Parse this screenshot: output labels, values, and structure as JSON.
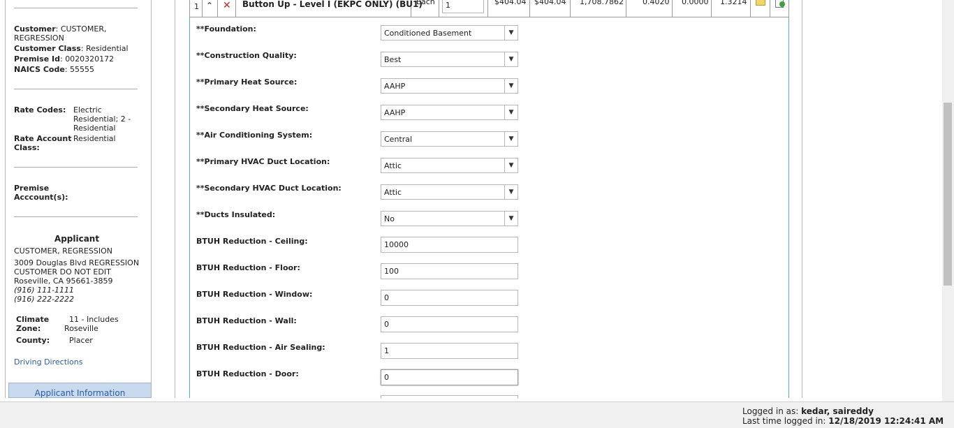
{
  "sidebar": {
    "customer_label": "Customer",
    "customer_value": "CUSTOMER,",
    "customer_value2": "REGRESSION",
    "customer_class_label": "Customer Class",
    "customer_class_value": "Residential",
    "premise_id_label": "Premise Id",
    "premise_id_value": "0020320172",
    "naics_label": "NAICS Code",
    "naics_value": "55555",
    "rate_codes_label": "Rate Codes:",
    "rate_codes_value": [
      "Electric",
      "Residential; 2 -",
      "Residential"
    ],
    "rate_account_label": [
      "Rate Account",
      "Class:"
    ],
    "rate_account_value": "Residential",
    "premise_accounts_label": [
      "Premise",
      "Acccount(s):"
    ],
    "applicant_heading": "Applicant",
    "applicant_name": "CUSTOMER, REGRESSION",
    "address_lines": [
      "3009 Douglas Blvd REGRESSION",
      "CUSTOMER DO NOT EDIT",
      "Roseville, CA 95661-3859"
    ],
    "phones": [
      "(916) 111-1111",
      "(916) 222-2222"
    ],
    "climate_zone_label": [
      "Climate",
      "Zone:"
    ],
    "climate_zone_value": [
      "11 - Includes",
      "Roseville"
    ],
    "county_label": "County:",
    "county_value": "Placer",
    "driving_directions": "Driving Directions",
    "applicant_info_tab": "Applicant Information"
  },
  "item_row": {
    "line_no": "1",
    "up_icon": "chevron-up-icon",
    "delete_icon": "close-icon",
    "description": "Button Up - Level I (EKPC ONLY) (BU1)",
    "unit": "Each",
    "quantity": "1",
    "price": "$404.04",
    "total": "$404.04",
    "kwh": "1,708.7862",
    "kw": "0.4020",
    "therms": "0.0000",
    "ratio": "1.3214",
    "note_icon": "note-icon",
    "add_icon": "add-document-icon"
  },
  "form": {
    "fields": [
      {
        "label": "**Foundation:",
        "type": "select",
        "value": "Conditioned Basement"
      },
      {
        "label": "**Construction Quality:",
        "type": "select",
        "value": "Best"
      },
      {
        "label": "**Primary Heat Source:",
        "type": "select",
        "value": "AAHP"
      },
      {
        "label": "**Secondary Heat Source:",
        "type": "select",
        "value": "AAHP"
      },
      {
        "label": "**Air Conditioning System:",
        "type": "select",
        "value": "Central"
      },
      {
        "label": "**Primary HVAC Duct Location:",
        "type": "select",
        "value": "Attic"
      },
      {
        "label": "**Secondary HVAC Duct Location:",
        "type": "select",
        "value": "Attic"
      },
      {
        "label": "**Ducts Insulated:",
        "type": "select",
        "value": "No"
      },
      {
        "label": "BTUH Reduction - Ceiling:",
        "type": "text",
        "value": "10000"
      },
      {
        "label": "BTUH Reduction - Floor:",
        "type": "text",
        "value": "100"
      },
      {
        "label": "BTUH Reduction - Window:",
        "type": "text",
        "value": "0"
      },
      {
        "label": "BTUH Reduction - Wall:",
        "type": "text",
        "value": "0"
      },
      {
        "label": "BTUH Reduction - Air Sealing:",
        "type": "text",
        "value": "1"
      },
      {
        "label": "BTUH Reduction - Door:",
        "type": "text",
        "value": "0"
      }
    ]
  },
  "status": {
    "logged_in_label": "Logged in as:",
    "logged_in_user": "kedar, saireddy",
    "last_login_label": "Last time logged in:",
    "last_login_value": "12/18/2019 12:24:41 AM"
  },
  "colors": {
    "panel_border": "#4fb3bf",
    "link": "#2a5d9f",
    "delete_red": "#d22222",
    "note_yellow": "#f1d46a"
  }
}
